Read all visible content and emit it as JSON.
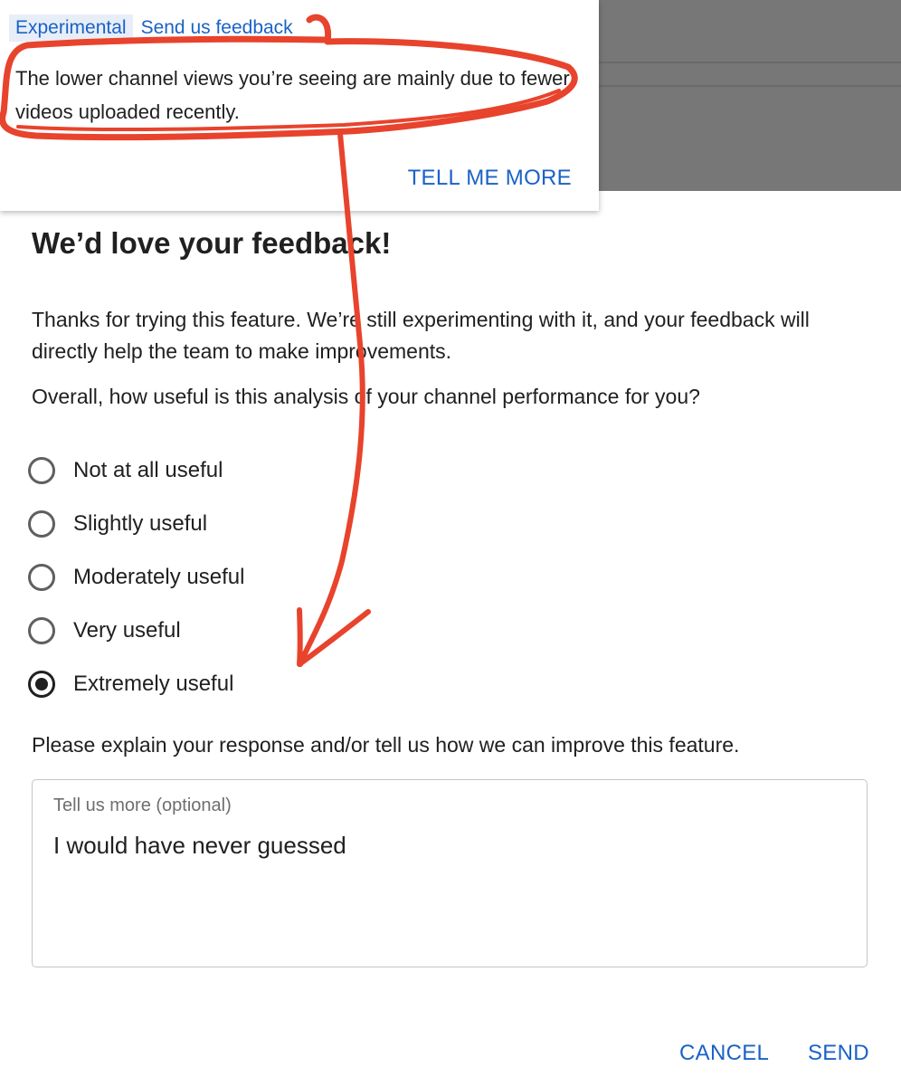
{
  "insight": {
    "tag": "Experimental",
    "feedback_link": "Send us feedback",
    "text": "The lower channel views you’re seeing are mainly due to fewer videos uploaded recently.",
    "action": "TELL ME MORE"
  },
  "dialog": {
    "title": "We’d love your feedback!",
    "intro": "Thanks for trying this feature. We’re still experimenting with it, and your feedback will directly help the team to make improvements.",
    "question": "Overall, how useful is this analysis of your channel performance for you?",
    "options": [
      {
        "label": "Not at all useful",
        "selected": false
      },
      {
        "label": "Slightly useful",
        "selected": false
      },
      {
        "label": "Moderately useful",
        "selected": false
      },
      {
        "label": "Very useful",
        "selected": false
      },
      {
        "label": "Extremely useful",
        "selected": true
      }
    ],
    "explain_label": "Please explain your response and/or tell us how we can improve this feature.",
    "textarea": {
      "label": "Tell us more (optional)",
      "value": "I would have never guessed"
    },
    "cancel_label": "CANCEL",
    "send_label": "SEND"
  },
  "colors": {
    "link": "#1a62c7",
    "annotation": "#e8432c",
    "backdrop": "#777777"
  }
}
